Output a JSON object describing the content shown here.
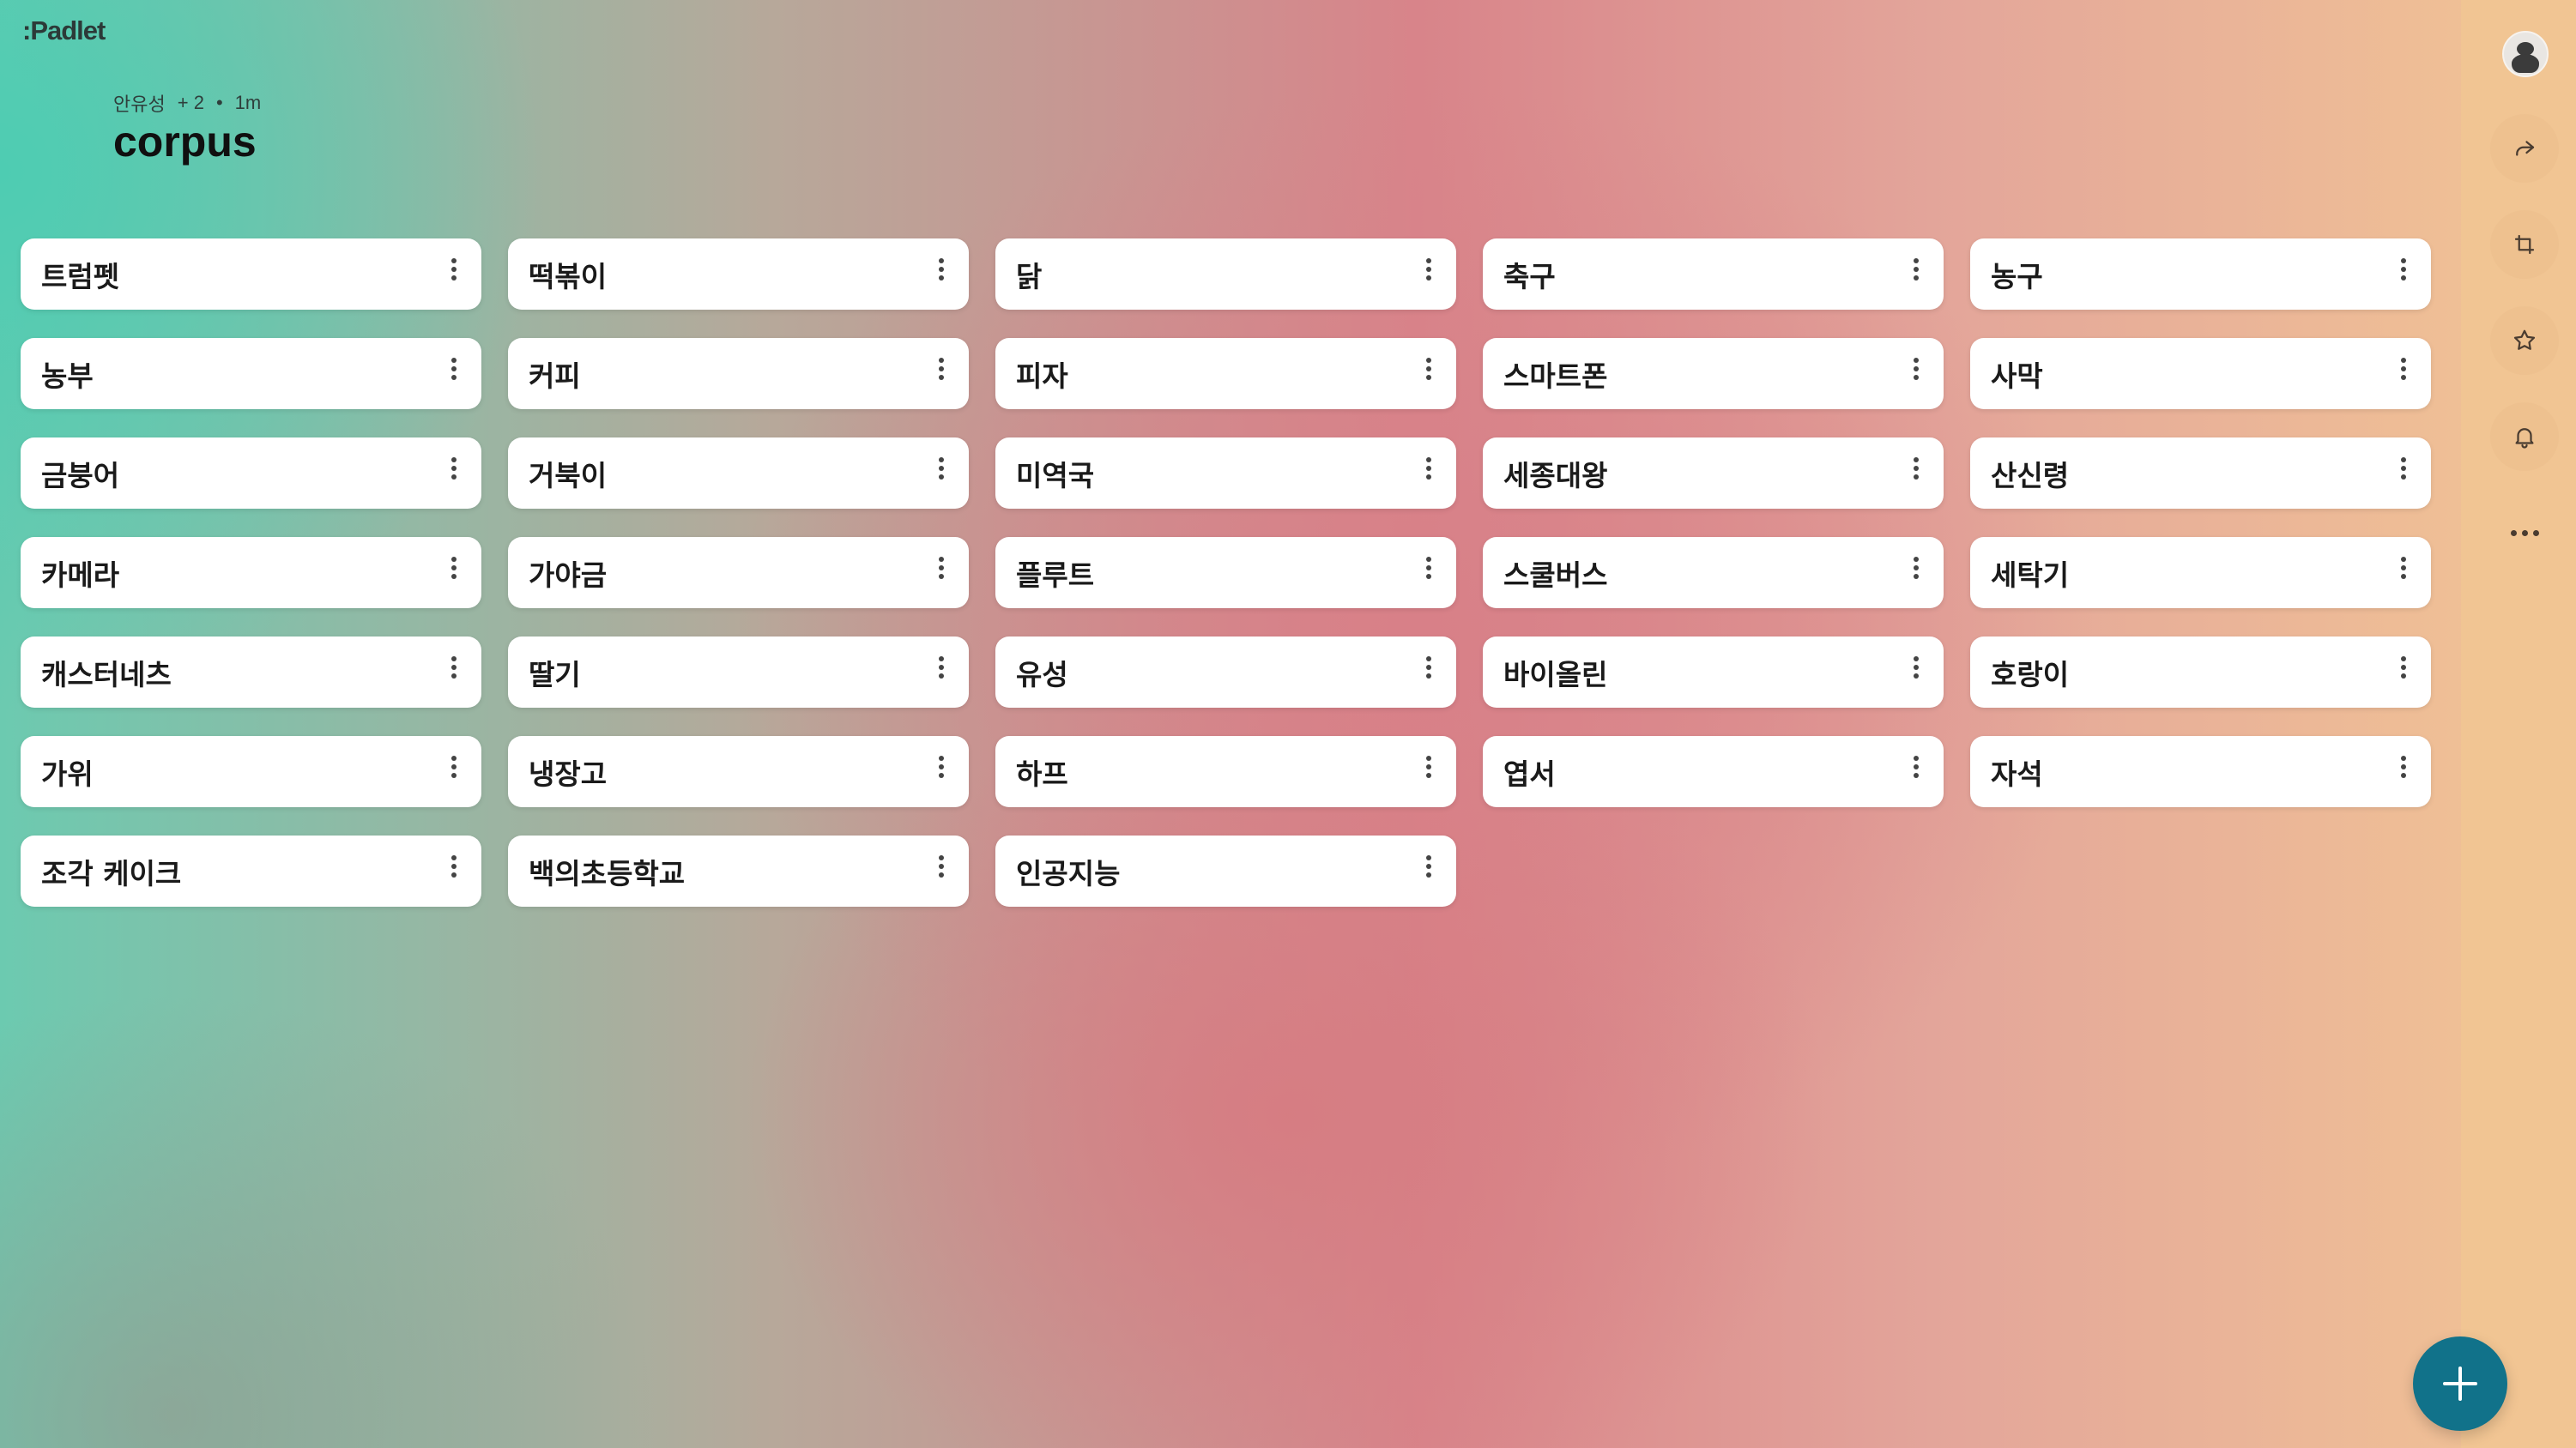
{
  "app": {
    "logo_text": ":Padlet"
  },
  "board": {
    "author": "안유성",
    "collaborators": "+ 2",
    "separator": "•",
    "updated": "1m",
    "title": "corpus"
  },
  "cards": [
    "트럼펫",
    "떡볶이",
    "닭",
    "축구",
    "농구",
    "농부",
    "커피",
    "피자",
    "스마트폰",
    "사막",
    "금붕어",
    "거북이",
    "미역국",
    "세종대왕",
    "산신령",
    "카메라",
    "가야금",
    "플루트",
    "스쿨버스",
    "세탁기",
    "캐스터네츠",
    "딸기",
    "유성",
    "바이올린",
    "호랑이",
    "가위",
    "냉장고",
    "하프",
    "엽서",
    "자석",
    "조각 케이크",
    "백의초등학교",
    "인공지능"
  ],
  "sidebar": {
    "icons": [
      "avatar",
      "share-icon",
      "remake-icon",
      "star-icon",
      "bell-icon",
      "more-icon"
    ]
  },
  "fab": {
    "icon": "plus-icon"
  },
  "colors": {
    "fab": "#11728a",
    "card": "#ffffff",
    "rail": "#f1c593"
  }
}
